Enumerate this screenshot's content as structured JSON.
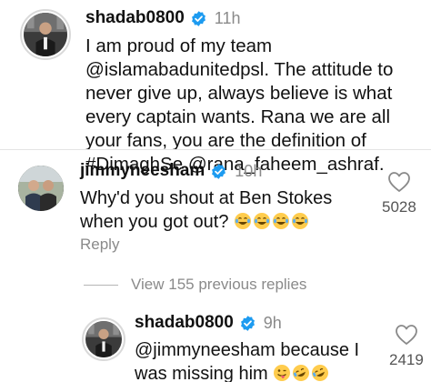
{
  "post": {
    "username": "shadab0800",
    "time": "11h",
    "caption_parts": [
      {
        "text": "I am proud of my team "
      },
      {
        "text": "@islamabadunitedpsl"
      },
      {
        "text": ". The attitude to never give up, always believe is what every captain wants. Rana we are all your fans, you are the definition of "
      },
      {
        "text": "#DimaghSe"
      },
      {
        "text": " "
      },
      {
        "text": "@rana_faheem_ashraf"
      },
      {
        "text": "."
      }
    ]
  },
  "comment": {
    "username": "jimmyneesham",
    "time": "10h",
    "text": "Why'd you shout at Ben Stokes when you got out?",
    "emoji_names": [
      "laughing-emoji",
      "laughing-emoji",
      "laughing-emoji",
      "laughing-emoji"
    ],
    "likes": "5028",
    "reply_label": "Reply"
  },
  "thread": {
    "view_replies": "View 155 previous replies"
  },
  "reply": {
    "username": "shadab0800",
    "time": "9h",
    "mention": "@jimmyneesham",
    "text": " because I was missing him",
    "emoji_names": [
      "winking-tongue-emoji",
      "rofl-emoji",
      "rofl-emoji"
    ],
    "likes": "2419"
  },
  "colors": {
    "text": "#111111",
    "muted": "#8a8a8a",
    "verified_blue": "#1d9bf0",
    "divider": "#e4e4e4"
  },
  "icons": {
    "verified": "verified-badge-icon",
    "like": "heart-outline-icon"
  }
}
